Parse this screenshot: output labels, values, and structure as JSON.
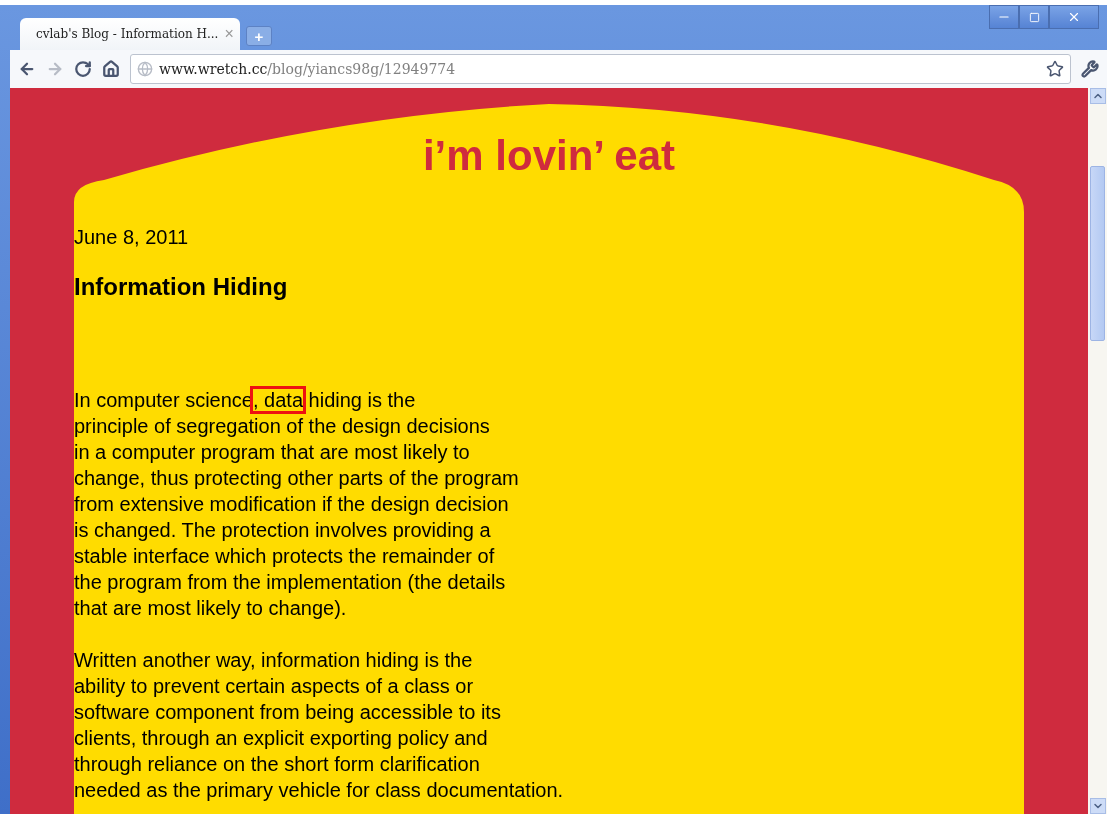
{
  "tab": {
    "title": "cvlab's Blog - Information H...",
    "close": "×",
    "new_tab": "+"
  },
  "address": {
    "host": "www.wretch.cc",
    "path": "/blog/yiancs98g/12949774"
  },
  "blog": {
    "title": "i’m lovin’ eat"
  },
  "post": {
    "date": "June 8, 2011",
    "title": "Information Hiding",
    "paragraphs": [
      {
        "lines": [
          [
            {
              "text": "In computer science",
              "kind": "plain"
            },
            {
              "text": ", data",
              "kind": "boxed"
            },
            {
              "text": " hiding is the",
              "kind": "plain"
            }
          ],
          [
            {
              "text": "principle of segregation of the design decisions",
              "kind": "plain"
            }
          ],
          [
            {
              "text": "in a computer program that are most likely to",
              "kind": "plain"
            }
          ],
          [
            {
              "text": "change, thus protecting other parts of the program",
              "kind": "plain"
            }
          ],
          [
            {
              "text": "from extensive modification if the design decision",
              "kind": "plain"
            }
          ],
          [
            {
              "text": "is changed. The protection involves providing a",
              "kind": "plain"
            }
          ],
          [
            {
              "text": "stable interface which protects the remainder of",
              "kind": "plain"
            }
          ],
          [
            {
              "text": "the program from the implementation (the details",
              "kind": "plain"
            }
          ],
          [
            {
              "text": "that are most likely to change).",
              "kind": "plain"
            }
          ]
        ]
      },
      {
        "lines": [
          [
            {
              "text": "Written another way, information hiding is the",
              "kind": "plain"
            }
          ],
          [
            {
              "text": "ability to prevent certain aspects of a class or",
              "kind": "plain"
            }
          ],
          [
            {
              "text": "software component from being accessible to its",
              "kind": "plain"
            }
          ],
          [
            {
              "text": "clients, through an explicit exporting policy and",
              "kind": "plain"
            }
          ],
          [
            {
              "text": "through reliance on the short form clarification",
              "kind": "plain"
            }
          ],
          [
            {
              "text": "needed as the primary vehicle for class documentation.",
              "kind": "plain"
            }
          ]
        ]
      }
    ]
  }
}
